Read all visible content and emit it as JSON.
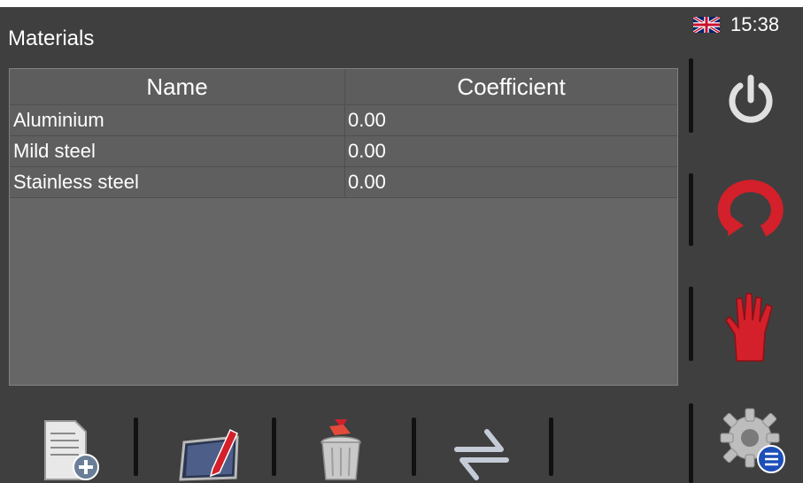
{
  "header": {
    "title": "Materials",
    "time": "15:38",
    "language_flag": "uk-flag-icon"
  },
  "table": {
    "columns": [
      "Name",
      "Coefficient"
    ],
    "rows": [
      {
        "name": "Aluminium",
        "coefficient": "0.00"
      },
      {
        "name": "Mild steel",
        "coefficient": "0.00"
      },
      {
        "name": "Stainless steel",
        "coefficient": "0.00"
      }
    ]
  },
  "sidebar": {
    "buttons": [
      "power-icon",
      "refresh-icon",
      "stop-hand-icon",
      "settings-gear-icon"
    ]
  },
  "toolbar": {
    "buttons": [
      "add-document-icon",
      "edit-icon",
      "delete-trash-icon",
      "swap-arrows-icon"
    ]
  },
  "colors": {
    "background": "#3f3f3f",
    "table": "#666666",
    "accent_red": "#d3202a"
  }
}
